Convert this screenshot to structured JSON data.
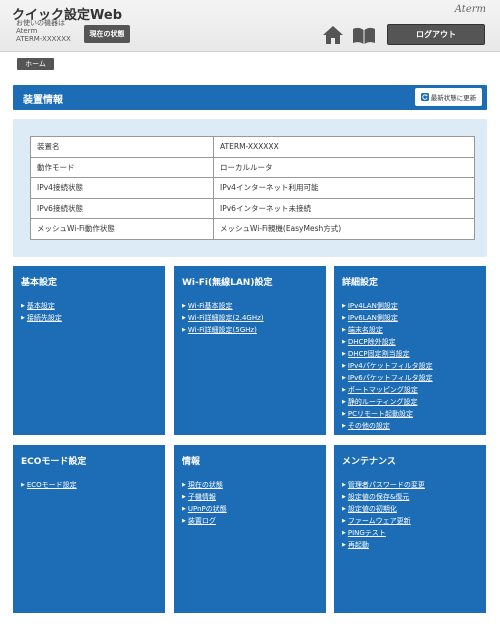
{
  "header": {
    "app_title": "クイック設定Web",
    "device_caption": "お使いの機器は",
    "device_name": "Aterm",
    "device_id": "ATERM-XXXXXX",
    "status_button": "現在の状態",
    "brand": "Aterm",
    "logout_button": "ログアウト"
  },
  "breadcrumb": {
    "home": "ホーム"
  },
  "section": {
    "title": "装置情報",
    "refresh_button": "最新状態に更新"
  },
  "info_table": [
    {
      "key": "装置名",
      "value": "ATERM-XXXXXX"
    },
    {
      "key": "動作モード",
      "value": "ローカルルータ"
    },
    {
      "key": "IPv4接続状態",
      "value": "IPv4インターネット利用可能"
    },
    {
      "key": "IPv6接続状態",
      "value": "IPv6インターネット未接続"
    },
    {
      "key": "メッシュWi-Fi動作状態",
      "value": "メッシュWi-Fi親機(EasyMesh方式)"
    }
  ],
  "cards": [
    {
      "title": "基本設定",
      "links": [
        "基本設定",
        "接続先設定"
      ]
    },
    {
      "title": "Wi-Fi(無線LAN)設定",
      "links": [
        "Wi-Fi基本設定",
        "Wi-Fi詳細設定(2.4GHz)",
        "Wi-Fi詳細設定(5GHz)"
      ]
    },
    {
      "title": "詳細設定",
      "links": [
        "IPv4LAN側設定",
        "IPv6LAN側設定",
        "端末名設定",
        "DHCP除外設定",
        "DHCP固定割当設定",
        "IPv4パケットフィルタ設定",
        "IPv6パケットフィルタ設定",
        "ポートマッピング設定",
        "静的ルーティング設定",
        "PCリモート起動設定",
        "その他の設定"
      ]
    },
    {
      "title": "ECOモード設定",
      "links": [
        "ECOモード設定"
      ]
    },
    {
      "title": "情報",
      "links": [
        "現在の状態",
        "子機情報",
        "UPnPの状態",
        "装置ログ"
      ]
    },
    {
      "title": "メンテナンス",
      "links": [
        "管理者パスワードの変更",
        "設定値の保存&復元",
        "設定値の初期化",
        "ファームウェア更新",
        "PINGテスト",
        "再起動"
      ]
    }
  ],
  "colors": {
    "accent": "#1c6db5",
    "panel": "#ddebf7",
    "button_dark": "#555555"
  },
  "icons": {
    "home": "home-icon",
    "manual": "book-icon",
    "refresh": "refresh-icon",
    "link_bullet": "triangle-right-icon"
  }
}
